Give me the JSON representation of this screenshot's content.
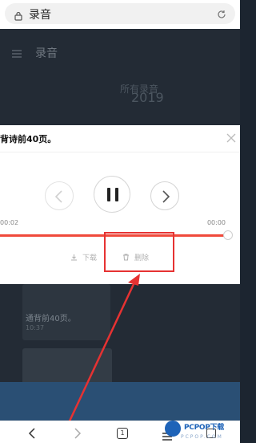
{
  "browser": {
    "page_title": "录音",
    "icons": {
      "lock": "lock-icon",
      "reload": "reload-icon"
    }
  },
  "app": {
    "title": "录音",
    "hero_label": "所有录音",
    "hero_year": "2019",
    "recording_card": {
      "title": "通背前40页。",
      "time": "10:37"
    }
  },
  "player": {
    "title": "背诗前40页。",
    "current_time": "00:02",
    "end_time": "00:00",
    "progress": 0.95,
    "download_label": "下载",
    "delete_label": "删除"
  },
  "bottom_nav": {
    "tabs_count": "1"
  },
  "watermark": {
    "text": "PCPOP下载",
    "sub": "PCPOP.COM"
  },
  "colors": {
    "accent": "#f04a3b",
    "highlight": "#e63232",
    "background": "#232b35",
    "footer": "#2a4f74"
  }
}
